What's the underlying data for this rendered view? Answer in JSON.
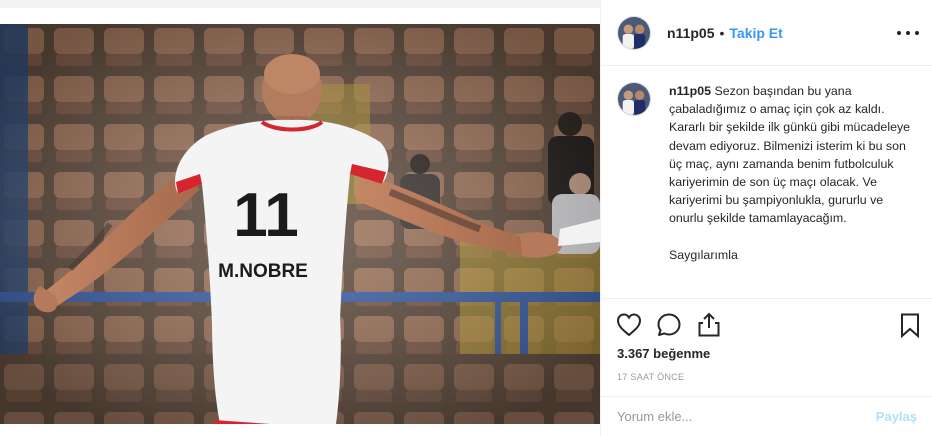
{
  "post": {
    "jersey_number": "11",
    "jersey_name": "M.NOBRE"
  },
  "header": {
    "username": "n11p05",
    "separator": "•",
    "follow_label": "Takip Et",
    "more_icon": "more-horizontal-icon"
  },
  "caption": {
    "username": "n11p05",
    "text": "Sezon başından bu yana çabaladığımız o amaç için çok az kaldı. Kararlı bir şekilde ilk günkü gibi mücadeleye devam ediyoruz. Bilmenizi isterim ki bu son üç maç, aynı zamanda benim futbolculuk kariyerimin de son üç maçı olacak. Ve kariyerimi bu şampiyonlukla, gururlu ve onurlu şekilde tamamlayacağım.\n\nSaygılarımla"
  },
  "actions": {
    "like_icon": "heart-icon",
    "comment_icon": "comment-icon",
    "share_icon": "share-icon",
    "save_icon": "bookmark-icon"
  },
  "likes": {
    "count": "3.367",
    "label": "beğenme"
  },
  "timestamp": "17 SAAT ÖNCE",
  "comment_box": {
    "placeholder": "Yorum ekle...",
    "post_label": "Paylaş"
  },
  "colors": {
    "link_blue": "#3897f0",
    "post_disabled": "#b2dffc",
    "divider": "#efefef",
    "muted": "#999999"
  }
}
